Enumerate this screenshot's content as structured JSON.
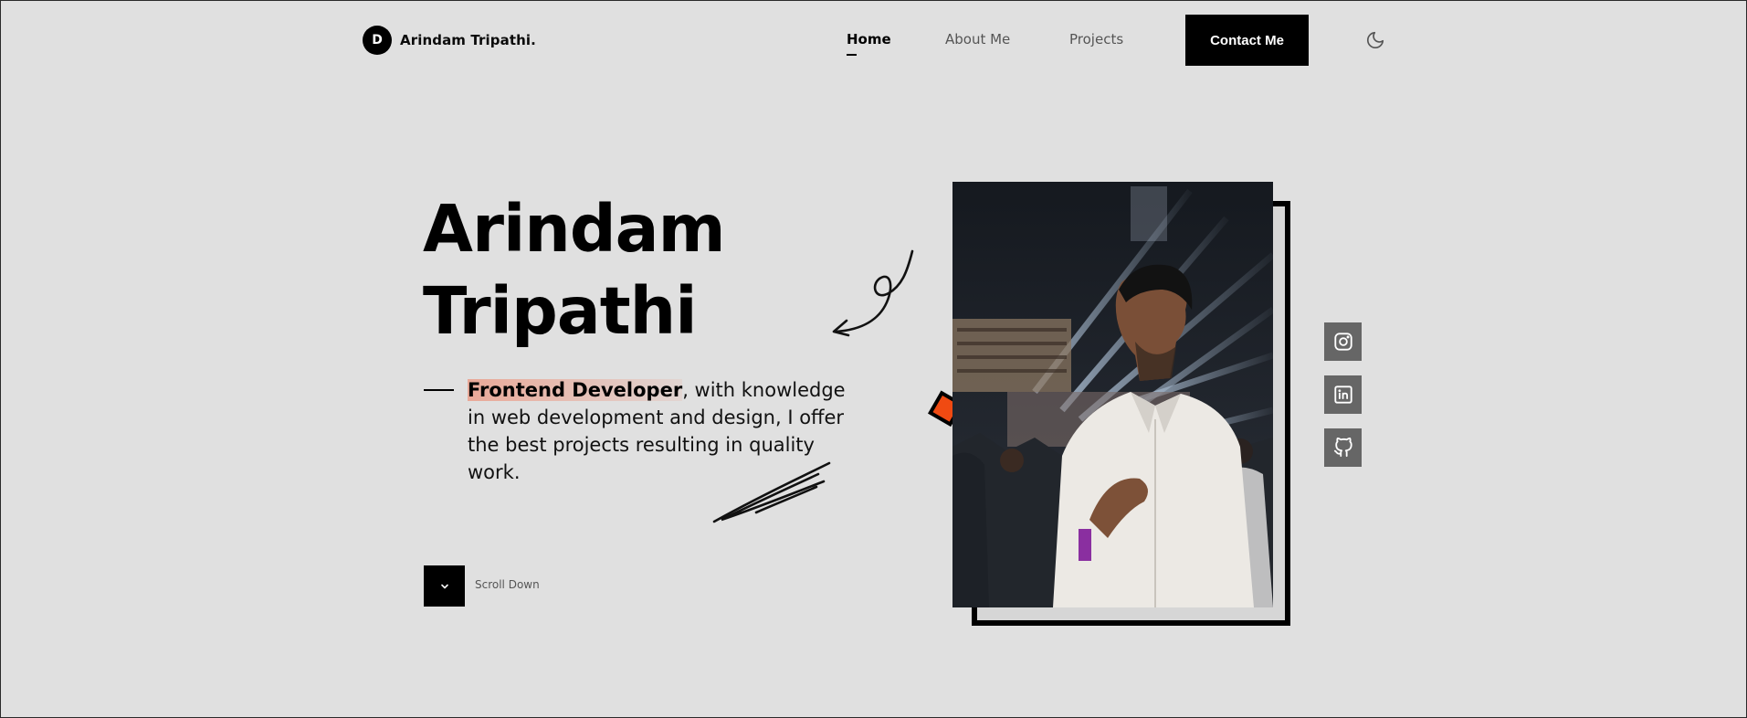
{
  "brand": {
    "initial": "D",
    "name": "Arindam Tripathi."
  },
  "nav": {
    "items": [
      {
        "label": "Home",
        "active": true
      },
      {
        "label": "About Me",
        "active": false
      },
      {
        "label": "Projects",
        "active": false
      }
    ],
    "contact_label": "Contact Me",
    "theme_icon": "moon-icon"
  },
  "hero": {
    "title_line1": "Arindam",
    "title_line2": "Tripathi",
    "role": "Frontend Developer",
    "description_rest": ", with knowledge in web development and design, I offer the best projects resulting in quality work.",
    "scroll_label": "Scroll Down",
    "accent_color": "#f04a12"
  },
  "social": [
    {
      "icon": "instagram-icon"
    },
    {
      "icon": "linkedin-icon"
    },
    {
      "icon": "github-icon"
    }
  ],
  "colors": {
    "background": "#e0e0e0",
    "primary": "#000000",
    "social_bg": "#666666"
  }
}
